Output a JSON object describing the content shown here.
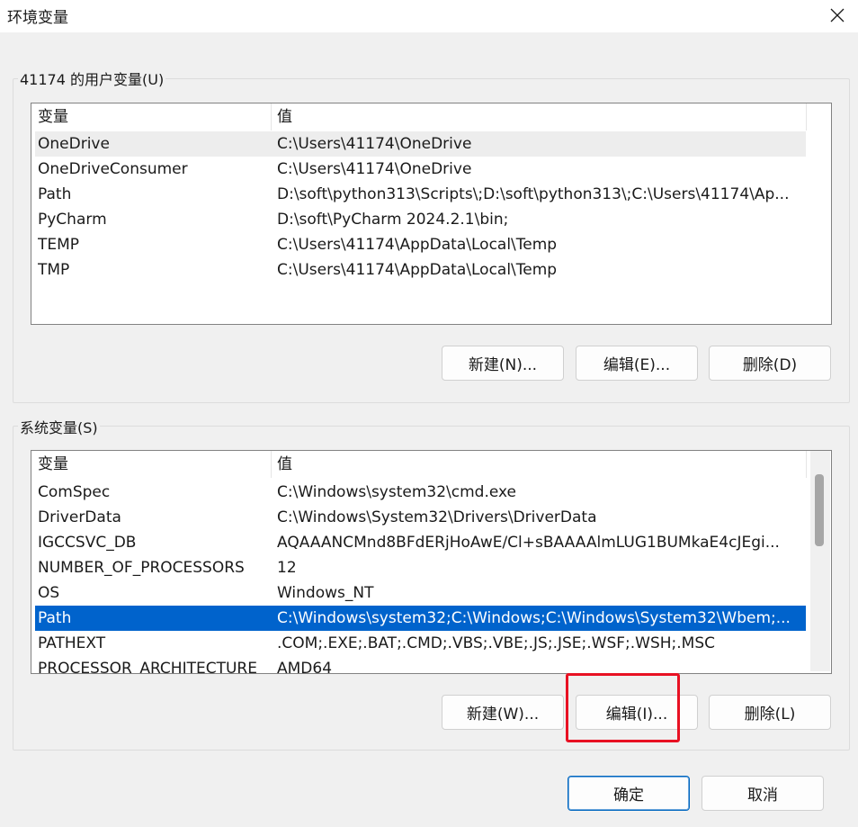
{
  "window": {
    "title": "环境变量"
  },
  "user_vars": {
    "group_label": "41174 的用户变量(U)",
    "columns": [
      "变量",
      "值"
    ],
    "rows": [
      {
        "name": "OneDrive",
        "value": "C:\\Users\\41174\\OneDrive"
      },
      {
        "name": "OneDriveConsumer",
        "value": "C:\\Users\\41174\\OneDrive"
      },
      {
        "name": "Path",
        "value": "D:\\soft\\python313\\Scripts\\;D:\\soft\\python313\\;C:\\Users\\41174\\Ap..."
      },
      {
        "name": "PyCharm",
        "value": "D:\\soft\\PyCharm 2024.2.1\\bin;"
      },
      {
        "name": "TEMP",
        "value": "C:\\Users\\41174\\AppData\\Local\\Temp"
      },
      {
        "name": "TMP",
        "value": "C:\\Users\\41174\\AppData\\Local\\Temp"
      }
    ],
    "buttons": {
      "new": "新建(N)...",
      "edit": "编辑(E)...",
      "delete": "删除(D)"
    }
  },
  "system_vars": {
    "group_label": "系统变量(S)",
    "columns": [
      "变量",
      "值"
    ],
    "rows": [
      {
        "name": "ComSpec",
        "value": "C:\\Windows\\system32\\cmd.exe"
      },
      {
        "name": "DriverData",
        "value": "C:\\Windows\\System32\\Drivers\\DriverData"
      },
      {
        "name": "IGCCSVC_DB",
        "value": "AQAAANCMnd8BFdERjHoAwE/Cl+sBAAAAlmLUG1BUMkaE4cJEgi..."
      },
      {
        "name": "NUMBER_OF_PROCESSORS",
        "value": "12"
      },
      {
        "name": "OS",
        "value": "Windows_NT"
      },
      {
        "name": "Path",
        "value": "C:\\Windows\\system32;C:\\Windows;C:\\Windows\\System32\\Wbem;..."
      },
      {
        "name": "PATHEXT",
        "value": ".COM;.EXE;.BAT;.CMD;.VBS;.VBE;.JS;.JSE;.WSF;.WSH;.MSC"
      },
      {
        "name": "PROCESSOR_ARCHITECTURE",
        "value": "AMD64"
      }
    ],
    "selected_row": "Path",
    "buttons": {
      "new": "新建(W)...",
      "edit": "编辑(I)...",
      "delete": "删除(L)"
    }
  },
  "footer": {
    "ok": "确定",
    "cancel": "取消"
  },
  "icons": {
    "close": "close-icon"
  },
  "colors": {
    "selection": "#0063cc",
    "highlight": "#e81123",
    "primary_border": "#0067c0"
  }
}
